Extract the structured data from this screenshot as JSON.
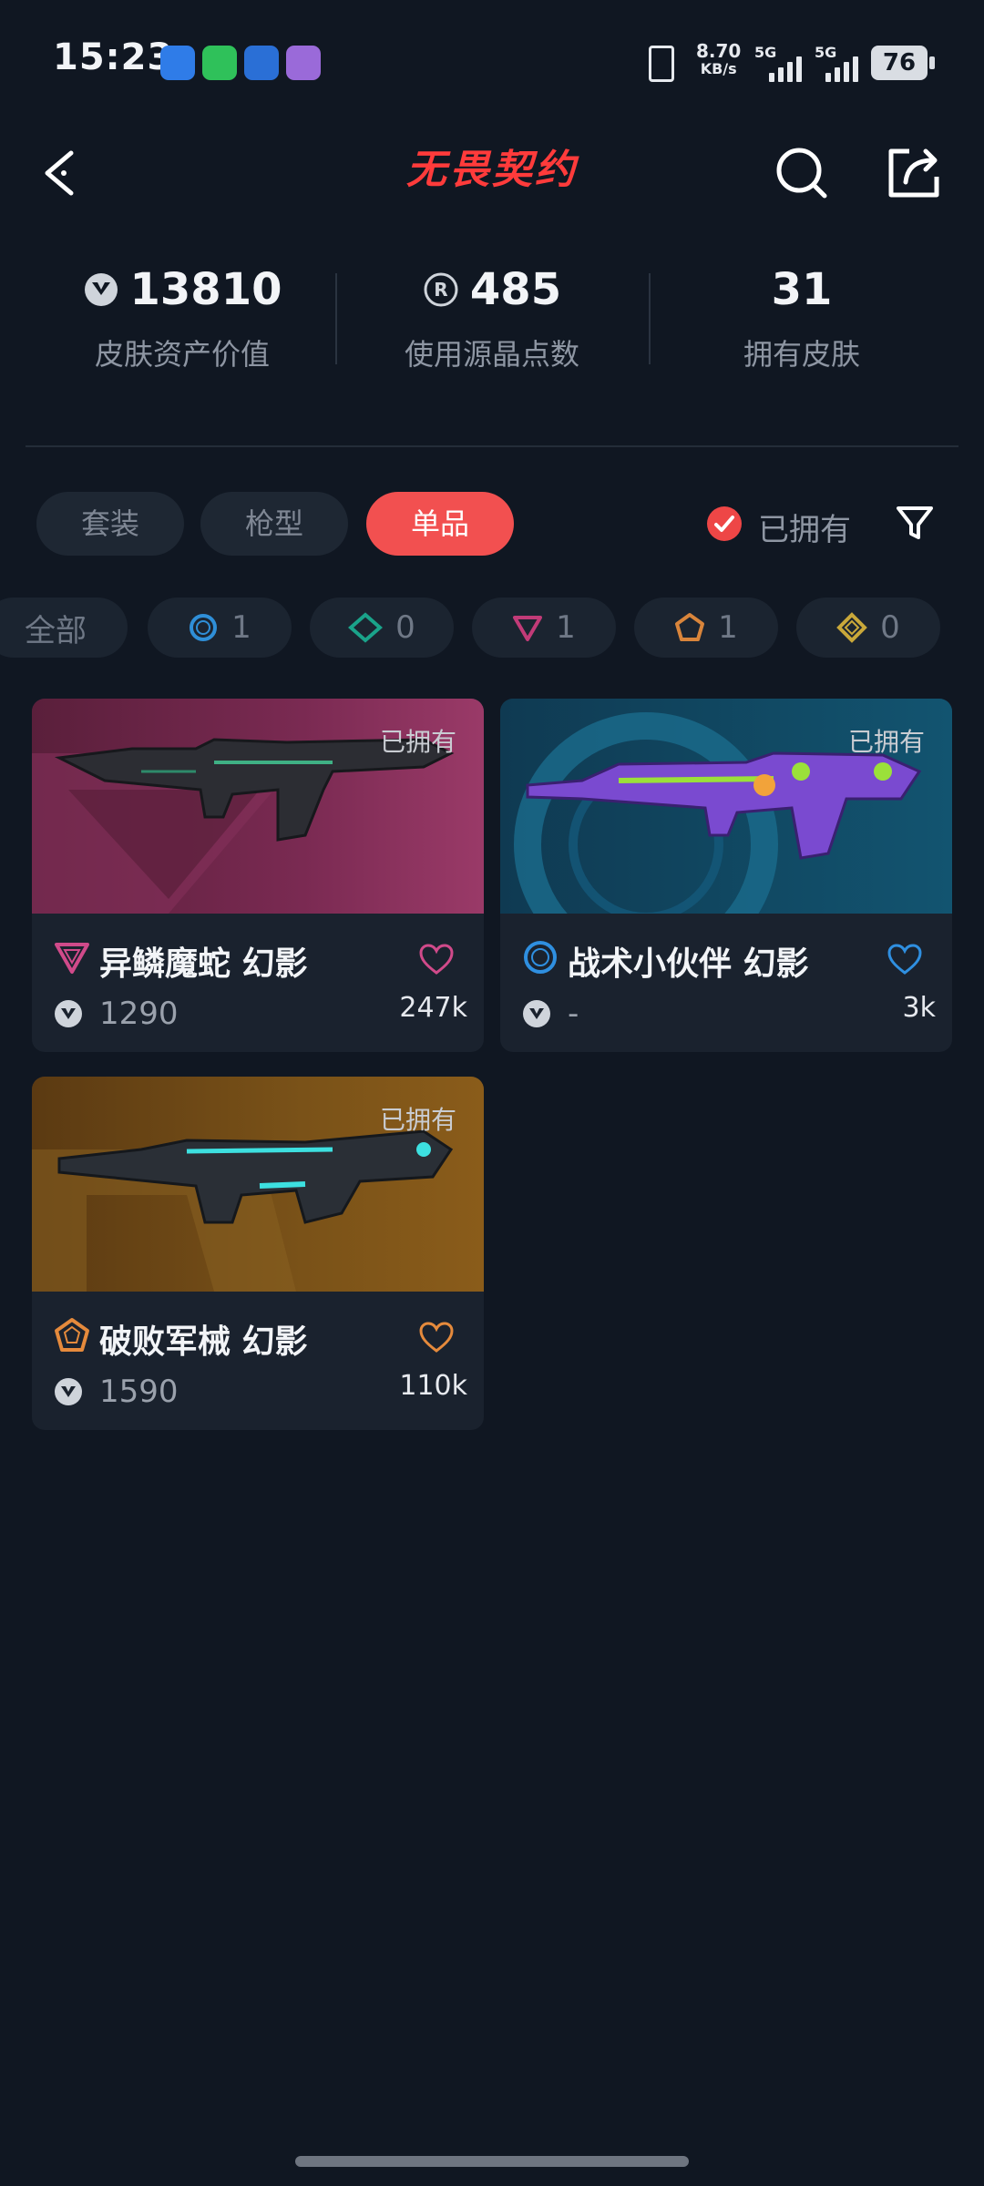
{
  "status_bar": {
    "time": "15:23",
    "net_speed_value": "8.70",
    "net_speed_unit": "KB/s",
    "net1": "5G",
    "net2": "5G",
    "battery": "76"
  },
  "header": {
    "title": "无畏契约",
    "back_icon": "chevron-left-icon",
    "search_icon": "search-icon",
    "share_icon": "share-icon"
  },
  "stats": [
    {
      "icon": "vp-icon",
      "value": "13810",
      "label": "皮肤资产价值"
    },
    {
      "icon": "radianite-icon",
      "value": "485",
      "label": "使用源晶点数"
    },
    {
      "icon": "",
      "value": "31",
      "label": "拥有皮肤"
    }
  ],
  "tabs": [
    {
      "label": "套装",
      "active": false
    },
    {
      "label": "枪型",
      "active": false
    },
    {
      "label": "单品",
      "active": true
    }
  ],
  "owned_filter": {
    "label": "已拥有",
    "checked": true
  },
  "rarity_chips": [
    {
      "label": "全部",
      "count": "",
      "color": ""
    },
    {
      "icon": "select-tier-icon",
      "count": "1",
      "color": "#2f8fd8"
    },
    {
      "icon": "deluxe-tier-icon",
      "count": "0",
      "color": "#1aa38a"
    },
    {
      "icon": "premium-tier-icon",
      "count": "1",
      "color": "#c23b78"
    },
    {
      "icon": "exclusive-tier-icon",
      "count": "1",
      "color": "#d9853b"
    },
    {
      "icon": "ultra-tier-icon",
      "count": "0",
      "color": "#c9a83a"
    }
  ],
  "cards": [
    {
      "owned": "已拥有",
      "name": "异鳞魔蛇 幻影",
      "price": "1290",
      "likes": "247k",
      "rarity_color": "#d04a8a",
      "heart_color": "#d04a8a",
      "bg": "#6b2447"
    },
    {
      "owned": "已拥有",
      "name": "战术小伙伴 幻影",
      "price": "-",
      "likes": "3k",
      "rarity_color": "#2f8fe0",
      "heart_color": "#2f8fe0",
      "bg": "#104863"
    },
    {
      "owned": "已拥有",
      "name": "破败军械 幻影",
      "price": "1590",
      "likes": "110k",
      "rarity_color": "#e58a3c",
      "heart_color": "#e58a3c",
      "bg": "#6a4213"
    }
  ]
}
